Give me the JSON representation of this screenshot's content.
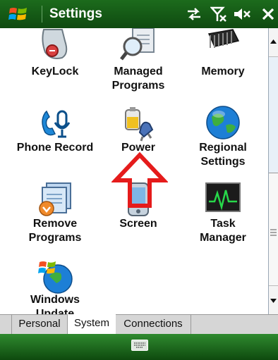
{
  "window": {
    "title": "Settings"
  },
  "status_icons": [
    "connectivity-icon",
    "no-signal-icon",
    "volume-muted-icon",
    "close-icon"
  ],
  "items": [
    {
      "label": [
        "KeyLock",
        ""
      ],
      "icon": "keylock-icon"
    },
    {
      "label": [
        "Managed",
        "Programs"
      ],
      "icon": "managed-programs-icon"
    },
    {
      "label": [
        "Memory",
        ""
      ],
      "icon": "memory-icon"
    },
    {
      "label": [
        "Phone Record",
        ""
      ],
      "icon": "phone-record-icon"
    },
    {
      "label": [
        "Power",
        ""
      ],
      "icon": "power-icon"
    },
    {
      "label": [
        "Regional",
        "Settings"
      ],
      "icon": "globe-icon"
    },
    {
      "label": [
        "Remove",
        "Programs"
      ],
      "icon": "remove-programs-icon"
    },
    {
      "label": [
        "Screen",
        ""
      ],
      "icon": "screen-icon"
    },
    {
      "label": [
        "Task",
        "Manager"
      ],
      "icon": "task-manager-icon"
    },
    {
      "label": [
        "Windows",
        "Update"
      ],
      "icon": "windows-update-icon"
    }
  ],
  "tabs": [
    {
      "label": "Personal",
      "active": false
    },
    {
      "label": "System",
      "active": true
    },
    {
      "label": "Connections",
      "active": false
    }
  ],
  "annotation": {
    "type": "arrow",
    "color": "#e51b1b",
    "points_to": "Power"
  },
  "colors": {
    "titlebar": "#1c6b1c",
    "bottombar": "#2f8a2f"
  }
}
